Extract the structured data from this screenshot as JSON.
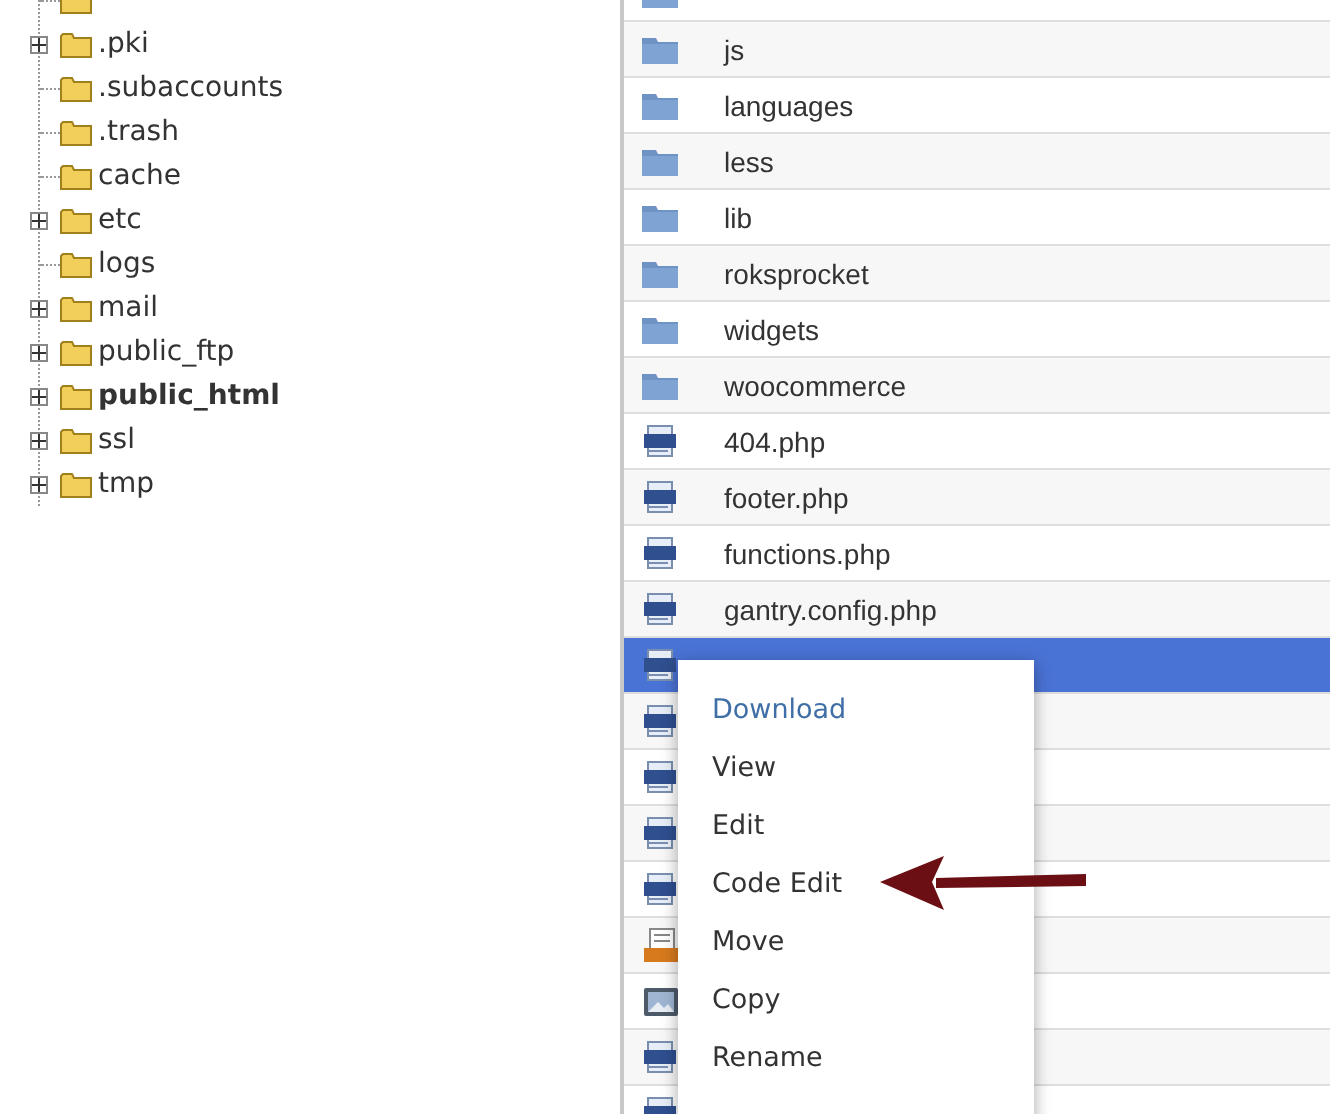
{
  "tree": [
    {
      "expandable": false
    },
    {
      "label": ".pki",
      "expandable": true,
      "bold": false
    },
    {
      "label": ".subaccounts",
      "expandable": false,
      "bold": false
    },
    {
      "label": ".trash",
      "expandable": false,
      "bold": false
    },
    {
      "label": "cache",
      "expandable": false,
      "bold": false
    },
    {
      "label": "etc",
      "expandable": true,
      "bold": false
    },
    {
      "label": "logs",
      "expandable": false,
      "bold": false
    },
    {
      "label": "mail",
      "expandable": true,
      "bold": false
    },
    {
      "label": "public_ftp",
      "expandable": true,
      "bold": false
    },
    {
      "label": "public_html",
      "expandable": true,
      "bold": true
    },
    {
      "label": "ssl",
      "expandable": true,
      "bold": false
    },
    {
      "label": "tmp",
      "expandable": true,
      "bold": false
    }
  ],
  "files": [
    {
      "kind": "folder",
      "selected": false
    },
    {
      "kind": "folder",
      "name": "js",
      "selected": false
    },
    {
      "kind": "folder",
      "name": "languages",
      "selected": false
    },
    {
      "kind": "folder",
      "name": "less",
      "selected": false
    },
    {
      "kind": "folder",
      "name": "lib",
      "selected": false
    },
    {
      "kind": "folder",
      "name": "roksprocket",
      "selected": false
    },
    {
      "kind": "folder",
      "name": "widgets",
      "selected": false
    },
    {
      "kind": "folder",
      "name": "woocommerce",
      "selected": false
    },
    {
      "kind": "php",
      "name": "404.php",
      "selected": false
    },
    {
      "kind": "php",
      "name": "footer.php",
      "selected": false
    },
    {
      "kind": "php",
      "name": "functions.php",
      "selected": false
    },
    {
      "kind": "php",
      "name": "gantry.config.php",
      "selected": false
    },
    {
      "kind": "php",
      "selected": true
    },
    {
      "kind": "php",
      "selected": false
    },
    {
      "kind": "php",
      "selected": false
    },
    {
      "kind": "php",
      "selected": false
    },
    {
      "kind": "php",
      "selected": false
    },
    {
      "kind": "css",
      "selected": false
    },
    {
      "kind": "image",
      "selected": false
    },
    {
      "kind": "php",
      "selected": false
    },
    {
      "kind": "php",
      "selected": false
    }
  ],
  "context_menu": [
    {
      "label": "Download",
      "highlighted": true
    },
    {
      "label": "View",
      "highlighted": false
    },
    {
      "label": "Edit",
      "highlighted": false
    },
    {
      "label": "Code Edit",
      "highlighted": false
    },
    {
      "label": "Move",
      "highlighted": false
    },
    {
      "label": "Copy",
      "highlighted": false
    },
    {
      "label": "Rename",
      "highlighted": false
    }
  ]
}
